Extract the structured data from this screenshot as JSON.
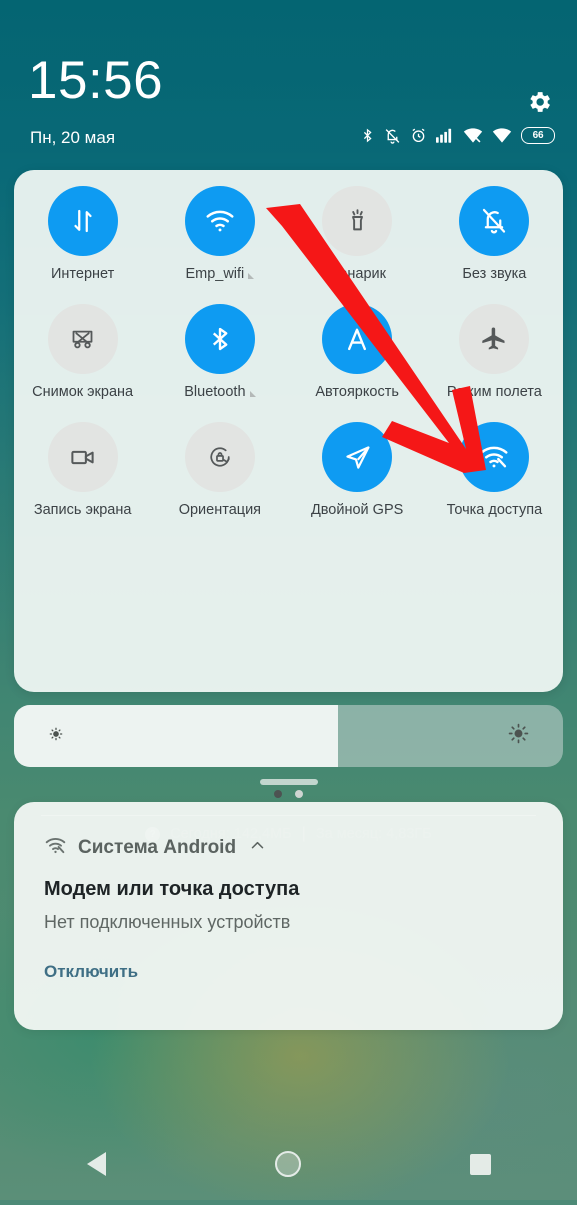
{
  "status_bar": {
    "time": "15:56",
    "date": "Пн, 20 мая",
    "battery_percent": "66",
    "icons": [
      "bluetooth-icon",
      "mute-bell-icon",
      "alarm-clock-icon",
      "signal-bars-icon",
      "hotspot-wifi-icon",
      "wifi-icon",
      "battery-icon"
    ],
    "settings_icon": "gear-icon"
  },
  "quick_settings": {
    "tiles": [
      {
        "label": "Интернет",
        "icon": "data-transfer-icon",
        "active": true,
        "has_caret": false
      },
      {
        "label": "Emp_wifi",
        "icon": "wifi-icon",
        "active": true,
        "has_caret": true
      },
      {
        "label": "Фонарик",
        "icon": "flashlight-icon",
        "active": false,
        "has_caret": false
      },
      {
        "label": "Без звука",
        "icon": "mute-bell-icon",
        "active": true,
        "has_caret": false
      },
      {
        "label": "Снимок экрана",
        "icon": "screenshot-icon",
        "active": false,
        "has_caret": false
      },
      {
        "label": "Bluetooth",
        "icon": "bluetooth-icon",
        "active": true,
        "has_caret": true
      },
      {
        "label": "Автояркость",
        "icon": "auto-brightness-icon",
        "active": true,
        "has_caret": false
      },
      {
        "label": "Режим полета",
        "icon": "airplane-icon",
        "active": false,
        "has_caret": false
      },
      {
        "label": "Запись экрана",
        "icon": "screen-record-icon",
        "active": false,
        "has_caret": false
      },
      {
        "label": "Ориентация",
        "icon": "rotation-lock-icon",
        "active": false,
        "has_caret": false
      },
      {
        "label": "Двойной GPS",
        "icon": "gps-arrow-icon",
        "active": true,
        "has_caret": false
      },
      {
        "label": "Точка доступа",
        "icon": "hotspot-icon",
        "active": true,
        "has_caret": false
      }
    ],
    "page_dots": {
      "count": 2,
      "active_index": 0
    },
    "data_usage": {
      "help_icon_label": "?",
      "today": "Сегодня: 142,4МБ",
      "separator": "|",
      "month": "За месяц: 4,83ГБ"
    }
  },
  "brightness": {
    "level_percent": 59,
    "low_icon": "sun-small-icon",
    "high_icon": "sun-large-icon"
  },
  "notification": {
    "app_name": "Система Android",
    "app_icon": "hotspot-icon",
    "collapse_icon": "chevron-up-icon",
    "title": "Модем или точка доступа",
    "subtitle": "Нет подключенных устройств",
    "action_label": "Отключить"
  },
  "nav_bar": {
    "back_label": "back-button",
    "home_label": "home-button",
    "recents_label": "recents-button"
  },
  "annotation": {
    "arrow_color": "#f51717",
    "points_to": "Точка доступа"
  },
  "colors": {
    "accent_blue": "#0e9bf2",
    "panel_bg": "#f0f6f3",
    "top_teal": "#04707f",
    "link_blue": "#3f6f85"
  }
}
